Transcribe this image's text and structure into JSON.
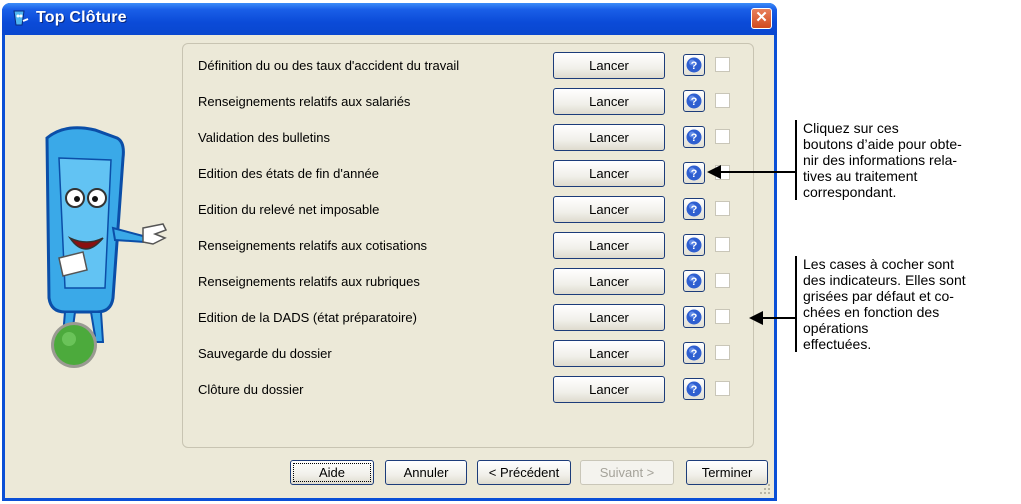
{
  "window": {
    "title": "Top Clôture",
    "close_glyph": "✕"
  },
  "steps": [
    {
      "label": "Définition du ou des taux d'accident du travail",
      "button": "Lancer",
      "checked": false
    },
    {
      "label": "Renseignements relatifs aux salariés",
      "button": "Lancer",
      "checked": false
    },
    {
      "label": "Validation des bulletins",
      "button": "Lancer",
      "checked": false
    },
    {
      "label": "Edition des états de fin d'année",
      "button": "Lancer",
      "checked": false
    },
    {
      "label": "Edition du relevé net imposable",
      "button": "Lancer",
      "checked": false
    },
    {
      "label": "Renseignements relatifs aux cotisations",
      "button": "Lancer",
      "checked": false
    },
    {
      "label": "Renseignements relatifs aux rubriques",
      "button": "Lancer",
      "checked": false
    },
    {
      "label": "Edition de la DADS (état préparatoire)",
      "button": "Lancer",
      "checked": false
    },
    {
      "label": "Sauvegarde du dossier",
      "button": "Lancer",
      "checked": false
    },
    {
      "label": "Clôture du dossier",
      "button": "Lancer",
      "checked": false
    }
  ],
  "footer": {
    "aide": "Aide",
    "annuler": "Annuler",
    "precedent": "< Précédent",
    "suivant": "Suivant >",
    "terminer": "Terminer"
  },
  "annotations": {
    "help_note": [
      "Cliquez sur ces",
      "boutons d’aide pour obte-",
      "nir des informations rela-",
      "tives au traitement",
      "correspondant."
    ],
    "checkbox_note": [
      "Les cases à cocher sont",
      "des indicateurs. Elles sont",
      "grisées par défaut et co-",
      "chées en fonction des",
      "opérations",
      "effectuées."
    ]
  },
  "icons": {
    "title": "mascot-icon",
    "help": "question-mark-icon",
    "grip": "resize-grip-icon"
  },
  "colors": {
    "titlebar": "#0b4bd8",
    "client": "#ece9d8",
    "close": "#d14a1d",
    "help_blue": "#2f5fd0",
    "led_green": "#4caa3c"
  }
}
